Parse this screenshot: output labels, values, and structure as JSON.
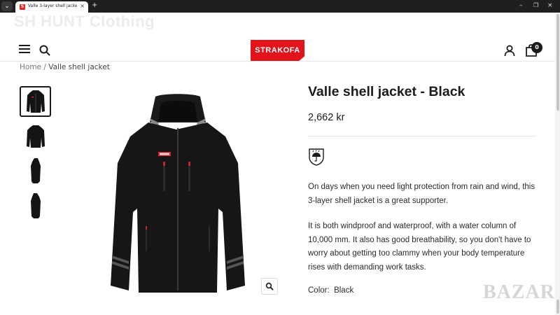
{
  "browser": {
    "tab_title": "Valle 3-layer shell jacket | Stra…",
    "tab_close": "×",
    "new_tab": "+",
    "nav_glyph": "⌄",
    "win_minimize": "–",
    "win_restore": "❐",
    "win_close": "×"
  },
  "store": {
    "ghost_title": "SH HUNT Clothing",
    "logo_text": "STRAKOFA",
    "cart_count": "0",
    "brand_color": "#e3131b"
  },
  "breadcrumb": {
    "home": "Home",
    "separator": " / ",
    "current": "Valle shell jacket"
  },
  "gallery": {
    "thumbnails": [
      {
        "view": "front",
        "active": true
      },
      {
        "view": "back",
        "active": false
      },
      {
        "view": "side-left",
        "active": false
      },
      {
        "view": "side-right",
        "active": false
      }
    ],
    "zoom_icon": "magnifier-icon"
  },
  "product": {
    "title": "Valle shell jacket - Black",
    "price": "2,662 kr",
    "feature_icon": "rain-umbrella-shield-icon",
    "description": [
      "On days when you need light protection from rain and wind, this 3-layer shell jacket is a great supporter.",
      "It is both windproof and waterproof, with a water column of 10,000 mm. It also has good breathability, so you don't have to worry about getting too clammy when your body temperature rises with demanding work tasks."
    ],
    "color_label": "Color:",
    "color_value": "Black"
  },
  "watermark": "BAZAR"
}
